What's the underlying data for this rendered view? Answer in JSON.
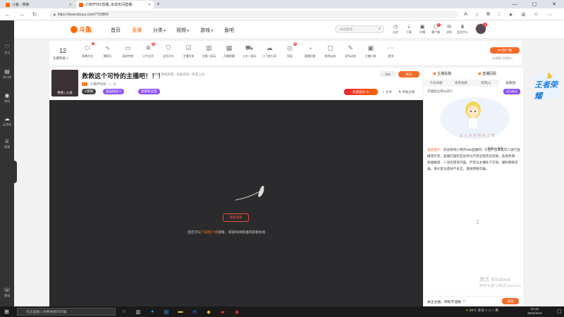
{
  "browser": {
    "tabs": [
      {
        "label": "斗鱼 - 搜索",
        "active": false
      },
      {
        "label": "小荷开555直播_永劫无间直播 - ",
        "active": true
      }
    ],
    "new_tab": "+",
    "url": "https://www.douyu.com/7793809",
    "window_controls": [
      "—",
      "▢",
      "✕"
    ]
  },
  "site": {
    "logo": "斗鱼",
    "nav": [
      "首页",
      "直播",
      "分类",
      "视频",
      "游戏",
      "鱼吧"
    ],
    "nav_active": "直播",
    "search_placeholder": "永劫游戏",
    "header_icons": [
      {
        "label": "历史",
        "icon": "history-icon",
        "glyph": "◷",
        "badge": ""
      },
      {
        "label": "下载",
        "icon": "download-icon",
        "glyph": "⤓",
        "badge": ""
      },
      {
        "label": "开播",
        "icon": "broadcast-icon",
        "glyph": "▣",
        "badge": ""
      },
      {
        "label": "客户端",
        "icon": "client-icon",
        "glyph": "☐",
        "badge": "4"
      },
      {
        "label": "消息",
        "icon": "message-icon",
        "glyph": "✉",
        "badge": ""
      },
      {
        "label": "会员中心",
        "icon": "vip-icon",
        "glyph": "♛",
        "badge": ""
      }
    ],
    "avatar_badge": "3"
  },
  "sidebar": [
    {
      "label": "关注",
      "glyph": "♡"
    },
    {
      "label": "排行榜",
      "glyph": "▤"
    },
    {
      "label": "游戏",
      "glyph": "◉"
    },
    {
      "label": "云游戏",
      "glyph": "☁"
    },
    {
      "label": "赛事",
      "glyph": "♕"
    },
    {
      "label": "客服",
      "glyph": "☏"
    }
  ],
  "toolbar": {
    "level": "12",
    "level_label": "主播等级",
    "tools": [
      {
        "label": "直播开启",
        "icon": "toggle-icon",
        "glyph": "⬭",
        "badge": "1"
      },
      {
        "label": "播音乐",
        "icon": "audio-icon",
        "glyph": "∿",
        "badge": ""
      },
      {
        "label": "画质特效",
        "icon": "quality-icon",
        "glyph": "▭",
        "badge": ""
      },
      {
        "label": "火力全开",
        "icon": "fire-icon",
        "glyph": "✲",
        "badge": "新"
      },
      {
        "label": "全民开车",
        "icon": "shield-icon",
        "glyph": "⛉",
        "badge": ""
      },
      {
        "label": "主播任务",
        "icon": "task-icon",
        "glyph": "☑",
        "badge": ""
      },
      {
        "label": "主播一起玩",
        "icon": "note-icon",
        "glyph": "▥",
        "badge": ""
      },
      {
        "label": "开播提醒",
        "icon": "calendar-icon",
        "glyph": "▦",
        "badge": ""
      },
      {
        "label": "上车一起玩",
        "icon": "car-icon",
        "glyph": "⛟",
        "badge": ""
      },
      {
        "label": "小飞侠分享",
        "icon": "cloud-icon",
        "glyph": "☁",
        "badge": ""
      },
      {
        "label": "发现",
        "icon": "discover-icon",
        "glyph": "◎",
        "badge": "新"
      },
      {
        "label": "直播回放",
        "icon": "gauge-icon",
        "glyph": "◔",
        "badge": ""
      },
      {
        "label": "鱼吧动态",
        "icon": "chat-icon",
        "glyph": "▢",
        "badge": ""
      },
      {
        "label": "发布动态",
        "icon": "edit-icon",
        "glyph": "✎",
        "badge": ""
      },
      {
        "label": "主播口袋",
        "icon": "pocket-icon",
        "glyph": "▣",
        "badge": ""
      },
      {
        "label": "更多",
        "icon": "more-icon",
        "glyph": "⋯",
        "badge": ""
      }
    ],
    "pc_button": "PC客户端",
    "pc_sub": "送弹幕/可领鱼丸"
  },
  "stream": {
    "title": "救救这个可怜的主播吧！！！",
    "category": "青铜  单机热游 › 永劫无间 › 开黑上分",
    "avatar_caption": "青桃 | 公会",
    "host": "小荷开555",
    "host_level": "4",
    "badges": [
      {
        "label": "V青铜",
        "color": "#444"
      },
      {
        "label": "猫猫挑战 0",
        "color": "#8c52ff"
      },
      {
        "label": "超级粉丝团",
        "color": "#8c52ff"
      }
    ],
    "view_count": "334",
    "follow": "关注",
    "hot": "热度超过  火  ",
    "share": "分享",
    "report": "举报主播"
  },
  "video": {
    "reload_button": "重新加载",
    "hint_prefix": "您还可以",
    "hint_link": "下载客户端",
    "hint_suffix": "观看，获得纯净极速的观看体验"
  },
  "rightpanel": {
    "tab_top_left": "主播投稿",
    "tab_top_right": "直播回看",
    "tabs": [
      "今日贡献",
      "本周贡献",
      "贵宾(1)",
      "钻粉团"
    ],
    "rank_label": "开播粉丝增长排行",
    "rank_button": "成为粉丝",
    "mascot_caption": "这 儿 未 有 粉 丝 上 榜",
    "sys_label": "系统提示：",
    "sys_message": "欢迎来到小荷开555直播间！斗鱼严禁未成年人进行直播或打赏，直播内容和互动评论严禁出现违法违规、低俗色情、吸烟酗酒、人身伤害等内容。严禁与主播私下交易，谨防网络诈骗。请大家注意财产安全，谨防网络诈骗。",
    "chat_options": "☐ 屏蔽  ☐ 清屏",
    "chat_placeholder": "关注主播，转粉不迷路",
    "send": "发送"
  },
  "watermark": {
    "line1": "激活 Windows",
    "line2": "转到\"设置\"以激活 Windows。"
  },
  "promo": "王者荣耀",
  "taskbar": {
    "search_placeholder": "在这里输入你要搜索的内容",
    "weather": "28°C 多云",
    "time": "15:19",
    "date": "2022/4/10"
  }
}
